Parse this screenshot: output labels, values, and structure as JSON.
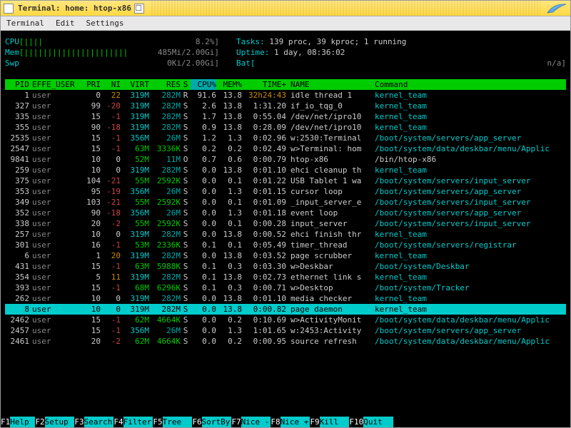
{
  "window": {
    "title": "Terminal: home: htop-x86"
  },
  "menubar": [
    "Terminal",
    "Edit",
    "Settings"
  ],
  "meters": {
    "cpu": {
      "label": "CPU",
      "bar": "[|||| ",
      "pct": "8.2%]"
    },
    "mem": {
      "label": "Mem",
      "bar": "[||||||||||||||||||||||",
      "val": "485Mi/2.00Gi]"
    },
    "swp": {
      "label": "Swp",
      "bar": "[",
      "val": "0Ki/2.00Gi]"
    },
    "tasks_label": "Tasks:",
    "tasks_val": "139 proc, 39 kproc; 1 running",
    "uptime_label": "Uptime:",
    "uptime_val": "1 day, 08:36:02",
    "bat_label": "Bat[",
    "bat_val": "n/a]"
  },
  "columns": {
    "pid": "PID",
    "user": "EFFE_USER",
    "pri": "PRI",
    "ni": "NI",
    "virt": "VIRT",
    "res": "RES",
    "s": "S",
    "cpu": "CPU%",
    "mem": "MEM%",
    "time": "TIME+",
    "name": "NAME",
    "cmd": "Command"
  },
  "processes": [
    {
      "pid": "1",
      "user": "user",
      "pri": "0",
      "ni": "22",
      "virt": "319M",
      "res": "282M",
      "s": "R",
      "cpu": "91.6",
      "mem": "13.8",
      "time": "32h24:43",
      "name": "idle thread 1",
      "cmd": "kernel_team",
      "pri_c": "white",
      "ni_c": "orange",
      "virt_c": "cyan",
      "res_c": "teal",
      "time_c": "orange",
      "name_c": "white",
      "cmd_c": "cyan"
    },
    {
      "pid": "327",
      "user": "user",
      "pri": "99",
      "ni": "-20",
      "virt": "319M",
      "res": "282M",
      "s": "S",
      "cpu": "2.6",
      "mem": "13.8",
      "time": "1:31.20",
      "name": "if_io_tqg_0",
      "cmd": "kernel_team",
      "pri_c": "white",
      "ni_c": "red",
      "virt_c": "cyan",
      "res_c": "teal",
      "time_c": "white",
      "name_c": "white",
      "cmd_c": "cyan"
    },
    {
      "pid": "335",
      "user": "user",
      "pri": "15",
      "ni": "-1",
      "virt": "319M",
      "res": "282M",
      "s": "S",
      "cpu": "1.7",
      "mem": "13.8",
      "time": "0:55.04",
      "name": "/dev/net/ipro10",
      "cmd": "kernel_team",
      "pri_c": "white",
      "ni_c": "red",
      "virt_c": "cyan",
      "res_c": "teal",
      "time_c": "white",
      "name_c": "white",
      "cmd_c": "cyan"
    },
    {
      "pid": "355",
      "user": "user",
      "pri": "90",
      "ni": "-18",
      "virt": "319M",
      "res": "282M",
      "s": "S",
      "cpu": "0.9",
      "mem": "13.8",
      "time": "0:28.09",
      "name": "/dev/net/ipro10",
      "cmd": "kernel_team",
      "pri_c": "white",
      "ni_c": "red",
      "virt_c": "cyan",
      "res_c": "teal",
      "time_c": "white",
      "name_c": "white",
      "cmd_c": "cyan"
    },
    {
      "pid": "2535",
      "user": "user",
      "pri": "15",
      "ni": "-1",
      "virt": "356M",
      "res": "26M",
      "s": "S",
      "cpu": "1.2",
      "mem": "1.3",
      "time": "0:02.96",
      "name": "w:2530:Terminal",
      "cmd": "/boot/system/servers/app_server",
      "pri_c": "white",
      "ni_c": "red",
      "virt_c": "cyan",
      "res_c": "teal",
      "time_c": "white",
      "name_c": "white",
      "cmd_c": "cyan"
    },
    {
      "pid": "2547",
      "user": "user",
      "pri": "15",
      "ni": "-1",
      "virt": "63M",
      "res": "3336K",
      "s": "S",
      "cpu": "0.2",
      "mem": "0.2",
      "time": "0:02.49",
      "name": "w>Terminal: hom",
      "cmd": "/boot/system/data/deskbar/menu/Applic",
      "pri_c": "white",
      "ni_c": "red",
      "virt_c": "green",
      "res_c": "green",
      "time_c": "white",
      "name_c": "white",
      "cmd_c": "cyan"
    },
    {
      "pid": "9841",
      "user": "user",
      "pri": "10",
      "ni": "0",
      "virt": "52M",
      "res": "11M",
      "s": "O",
      "cpu": "0.7",
      "mem": "0.6",
      "time": "0:00.79",
      "name": "htop-x86",
      "cmd": "/bin/htop-x86",
      "pri_c": "white",
      "ni_c": "white",
      "virt_c": "green",
      "res_c": "teal",
      "time_c": "white",
      "name_c": "white",
      "cmd_c": "white"
    },
    {
      "pid": "259",
      "user": "user",
      "pri": "10",
      "ni": "0",
      "virt": "319M",
      "res": "282M",
      "s": "S",
      "cpu": "0.0",
      "mem": "13.8",
      "time": "0:01.10",
      "name": "ehci cleanup th",
      "cmd": "kernel_team",
      "pri_c": "white",
      "ni_c": "white",
      "virt_c": "cyan",
      "res_c": "teal",
      "time_c": "white",
      "name_c": "white",
      "cmd_c": "cyan"
    },
    {
      "pid": "375",
      "user": "user",
      "pri": "104",
      "ni": "-21",
      "virt": "55M",
      "res": "2592K",
      "s": "S",
      "cpu": "0.0",
      "mem": "0.1",
      "time": "0:01.22",
      "name": "USB Tablet 1 wa",
      "cmd": "/boot/system/servers/input_server",
      "pri_c": "white",
      "ni_c": "red",
      "virt_c": "green",
      "res_c": "green",
      "time_c": "white",
      "name_c": "white",
      "cmd_c": "cyan"
    },
    {
      "pid": "353",
      "user": "user",
      "pri": "95",
      "ni": "-19",
      "virt": "356M",
      "res": "26M",
      "s": "S",
      "cpu": "0.0",
      "mem": "1.3",
      "time": "0:01.15",
      "name": "cursor loop",
      "cmd": "/boot/system/servers/app_server",
      "pri_c": "white",
      "ni_c": "red",
      "virt_c": "cyan",
      "res_c": "teal",
      "time_c": "white",
      "name_c": "white",
      "cmd_c": "cyan"
    },
    {
      "pid": "349",
      "user": "user",
      "pri": "103",
      "ni": "-21",
      "virt": "55M",
      "res": "2592K",
      "s": "S",
      "cpu": "0.0",
      "mem": "0.1",
      "time": "0:01.09",
      "name": "_input_server_e",
      "cmd": "/boot/system/servers/input_server",
      "pri_c": "white",
      "ni_c": "red",
      "virt_c": "green",
      "res_c": "green",
      "time_c": "white",
      "name_c": "white",
      "cmd_c": "cyan"
    },
    {
      "pid": "352",
      "user": "user",
      "pri": "90",
      "ni": "-18",
      "virt": "356M",
      "res": "26M",
      "s": "S",
      "cpu": "0.0",
      "mem": "1.3",
      "time": "0:01.18",
      "name": "event loop",
      "cmd": "/boot/system/servers/app_server",
      "pri_c": "white",
      "ni_c": "red",
      "virt_c": "cyan",
      "res_c": "teal",
      "time_c": "white",
      "name_c": "white",
      "cmd_c": "cyan"
    },
    {
      "pid": "338",
      "user": "user",
      "pri": "20",
      "ni": "-2",
      "virt": "55M",
      "res": "2592K",
      "s": "S",
      "cpu": "0.0",
      "mem": "0.1",
      "time": "0:00.28",
      "name": "input_server",
      "cmd": "/boot/system/servers/input_server",
      "pri_c": "white",
      "ni_c": "red",
      "virt_c": "green",
      "res_c": "green",
      "time_c": "white",
      "name_c": "white",
      "cmd_c": "cyan"
    },
    {
      "pid": "257",
      "user": "user",
      "pri": "10",
      "ni": "0",
      "virt": "319M",
      "res": "282M",
      "s": "S",
      "cpu": "0.0",
      "mem": "13.8",
      "time": "0:00.52",
      "name": "ehci finish thr",
      "cmd": "kernel_team",
      "pri_c": "white",
      "ni_c": "white",
      "virt_c": "cyan",
      "res_c": "teal",
      "time_c": "white",
      "name_c": "white",
      "cmd_c": "cyan"
    },
    {
      "pid": "301",
      "user": "user",
      "pri": "16",
      "ni": "-1",
      "virt": "53M",
      "res": "2336K",
      "s": "S",
      "cpu": "0.1",
      "mem": "0.1",
      "time": "0:05.49",
      "name": "timer_thread",
      "cmd": "/boot/system/servers/registrar",
      "pri_c": "white",
      "ni_c": "red",
      "virt_c": "green",
      "res_c": "green",
      "time_c": "white",
      "name_c": "white",
      "cmd_c": "cyan"
    },
    {
      "pid": "6",
      "user": "user",
      "pri": "1",
      "ni": "20",
      "virt": "319M",
      "res": "282M",
      "s": "S",
      "cpu": "0.0",
      "mem": "13.8",
      "time": "0:03.52",
      "name": "page scrubber",
      "cmd": "kernel_team",
      "pri_c": "white",
      "ni_c": "orange",
      "virt_c": "cyan",
      "res_c": "teal",
      "time_c": "white",
      "name_c": "white",
      "cmd_c": "cyan"
    },
    {
      "pid": "431",
      "user": "user",
      "pri": "15",
      "ni": "-1",
      "virt": "63M",
      "res": "5988K",
      "s": "S",
      "cpu": "0.1",
      "mem": "0.3",
      "time": "0:03.30",
      "name": "w>Deskbar",
      "cmd": "/boot/system/Deskbar",
      "pri_c": "white",
      "ni_c": "red",
      "virt_c": "green",
      "res_c": "green",
      "time_c": "white",
      "name_c": "white",
      "cmd_c": "cyan"
    },
    {
      "pid": "354",
      "user": "user",
      "pri": "5",
      "ni": "11",
      "virt": "319M",
      "res": "282M",
      "s": "S",
      "cpu": "0.1",
      "mem": "13.8",
      "time": "0:02.73",
      "name": "ethernet link s",
      "cmd": "kernel_team",
      "pri_c": "white",
      "ni_c": "orange",
      "virt_c": "cyan",
      "res_c": "teal",
      "time_c": "white",
      "name_c": "white",
      "cmd_c": "cyan"
    },
    {
      "pid": "393",
      "user": "user",
      "pri": "15",
      "ni": "-1",
      "virt": "68M",
      "res": "6296K",
      "s": "S",
      "cpu": "0.1",
      "mem": "0.3",
      "time": "0:00.71",
      "name": "w>Desktop",
      "cmd": "/boot/system/Tracker",
      "pri_c": "white",
      "ni_c": "red",
      "virt_c": "green",
      "res_c": "green",
      "time_c": "white",
      "name_c": "white",
      "cmd_c": "cyan"
    },
    {
      "pid": "262",
      "user": "user",
      "pri": "10",
      "ni": "0",
      "virt": "319M",
      "res": "282M",
      "s": "S",
      "cpu": "0.0",
      "mem": "13.8",
      "time": "0:01.10",
      "name": "media checker",
      "cmd": "kernel_team",
      "pri_c": "white",
      "ni_c": "white",
      "virt_c": "cyan",
      "res_c": "teal",
      "time_c": "white",
      "name_c": "white",
      "cmd_c": "cyan"
    },
    {
      "pid": "8",
      "user": "user",
      "pri": "10",
      "ni": "0",
      "virt": "319M",
      "res": "282M",
      "s": "S",
      "cpu": "0.0",
      "mem": "13.8",
      "time": "0:00.82",
      "name": "page daemon",
      "cmd": "kernel_team",
      "sel": true
    },
    {
      "pid": "2462",
      "user": "user",
      "pri": "15",
      "ni": "-1",
      "virt": "62M",
      "res": "4664K",
      "s": "S",
      "cpu": "0.0",
      "mem": "0.2",
      "time": "0:10.69",
      "name": "w>ActivityMonit",
      "cmd": "/boot/system/data/deskbar/menu/Applic",
      "pri_c": "white",
      "ni_c": "red",
      "virt_c": "green",
      "res_c": "green",
      "time_c": "white",
      "name_c": "white",
      "cmd_c": "cyan"
    },
    {
      "pid": "2457",
      "user": "user",
      "pri": "15",
      "ni": "-1",
      "virt": "356M",
      "res": "26M",
      "s": "S",
      "cpu": "0.0",
      "mem": "1.3",
      "time": "1:01.65",
      "name": "w:2453:Activity",
      "cmd": "/boot/system/servers/app_server",
      "pri_c": "white",
      "ni_c": "red",
      "virt_c": "cyan",
      "res_c": "teal",
      "time_c": "white",
      "name_c": "white",
      "cmd_c": "cyan"
    },
    {
      "pid": "2461",
      "user": "user",
      "pri": "20",
      "ni": "-2",
      "virt": "62M",
      "res": "4664K",
      "s": "S",
      "cpu": "0.0",
      "mem": "0.2",
      "time": "0:00.95",
      "name": "source refresh",
      "cmd": "/boot/system/data/deskbar/menu/Applic",
      "pri_c": "white",
      "ni_c": "red",
      "virt_c": "green",
      "res_c": "green",
      "time_c": "white",
      "name_c": "white",
      "cmd_c": "cyan"
    }
  ],
  "fkeys": [
    {
      "k": "F1",
      "l": "Help "
    },
    {
      "k": "F2",
      "l": "Setup "
    },
    {
      "k": "F3",
      "l": "Search"
    },
    {
      "k": "F4",
      "l": "Filter"
    },
    {
      "k": "F5",
      "l": "Tree  "
    },
    {
      "k": "F6",
      "l": "SortBy"
    },
    {
      "k": "F7",
      "l": "Nice -"
    },
    {
      "k": "F8",
      "l": "Nice +"
    },
    {
      "k": "F9",
      "l": "Kill  "
    },
    {
      "k": "F10",
      "l": "Quit  "
    }
  ]
}
